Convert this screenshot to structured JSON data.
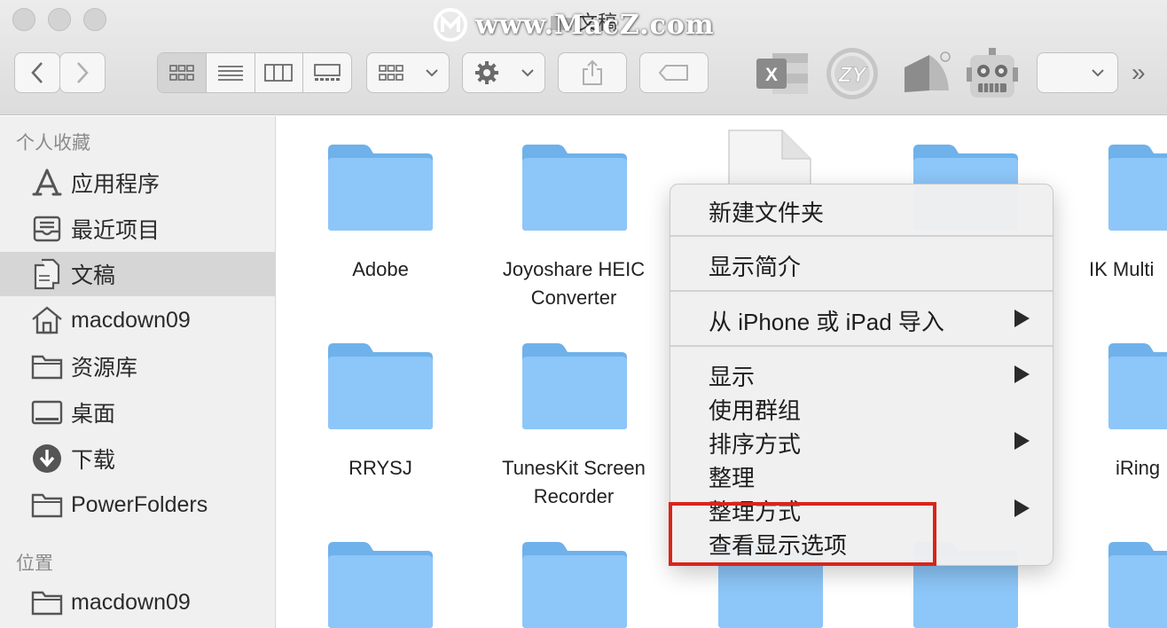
{
  "window": {
    "title": "文稿"
  },
  "watermark": "www.MacZ.com",
  "toolbar": {
    "back": "back",
    "forward": "forward",
    "view_modes": [
      "icon",
      "list",
      "column",
      "gallery"
    ],
    "group_by": "group",
    "action": "action",
    "share": "share",
    "tags": "tags",
    "apps": [
      "excel",
      "zy",
      "mosaic",
      "robot"
    ],
    "dropdown_value": ""
  },
  "sidebar": {
    "favorites_header": "个人收藏",
    "favorites": [
      {
        "label": "应用程序",
        "icon": "applications-icon"
      },
      {
        "label": "最近项目",
        "icon": "recents-icon"
      },
      {
        "label": "文稿",
        "icon": "documents-icon",
        "selected": true
      },
      {
        "label": "macdown09",
        "icon": "home-icon"
      },
      {
        "label": "资源库",
        "icon": "folder-icon"
      },
      {
        "label": "桌面",
        "icon": "desktop-icon"
      },
      {
        "label": "下载",
        "icon": "downloads-icon"
      },
      {
        "label": "PowerFolders",
        "icon": "folder-icon"
      }
    ],
    "locations_header": "位置",
    "locations": [
      {
        "label": "macdown09",
        "icon": "folder-icon"
      }
    ]
  },
  "content": {
    "items": [
      {
        "name": "Adobe",
        "name2": ""
      },
      {
        "name": "Joyoshare HEIC",
        "name2": "Converter"
      },
      {
        "name": "IK Multi",
        "name2": ""
      },
      {
        "name": "RRYSJ",
        "name2": ""
      },
      {
        "name": "TunesKit Screen",
        "name2": "Recorder"
      },
      {
        "name": "iRing",
        "name2": ""
      }
    ]
  },
  "context_menu": {
    "items": [
      {
        "label": "新建文件夹"
      },
      {
        "label": "显示简介"
      },
      {
        "label": "从 iPhone 或 iPad 导入",
        "submenu": true
      },
      {
        "label": "显示",
        "submenu": true
      },
      {
        "label": "使用群组"
      },
      {
        "label": "排序方式",
        "submenu": true
      },
      {
        "label": "整理"
      },
      {
        "label": "整理方式",
        "submenu": true
      },
      {
        "label": "查看显示选项"
      }
    ]
  },
  "colors": {
    "folder": "#84c3f7",
    "selection": "#d6d6d6",
    "highlight": "#d9241b"
  }
}
